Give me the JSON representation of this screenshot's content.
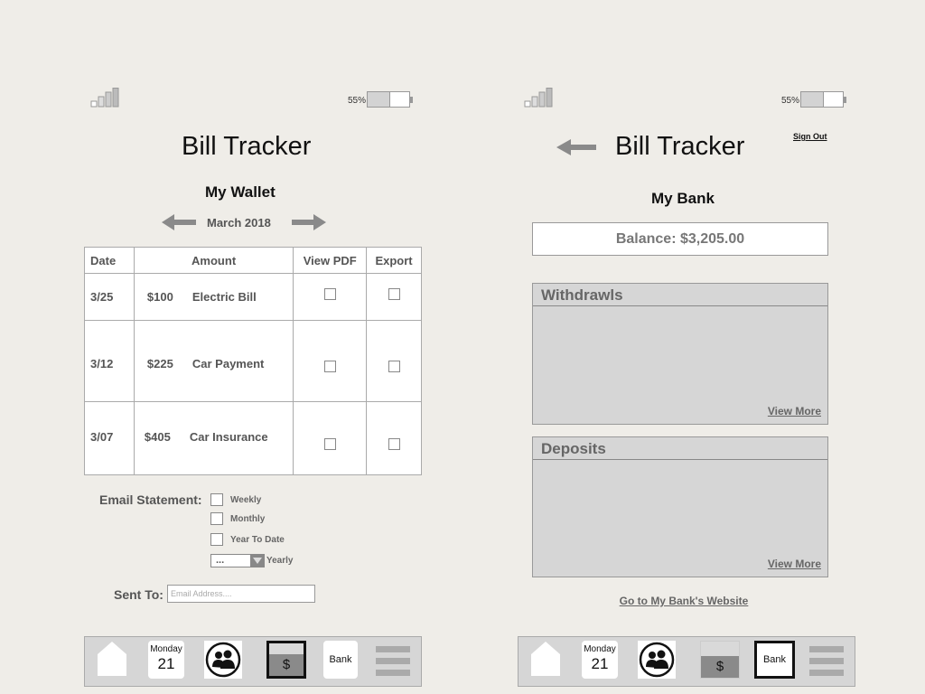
{
  "status": {
    "battery_label": "55%",
    "battery_level_percent": 55
  },
  "left": {
    "title": "Bill Tracker",
    "section": "My Wallet",
    "month": "March 2018",
    "table": {
      "headers": [
        "Date",
        "Amount",
        "View PDF",
        "Export"
      ],
      "rows": [
        {
          "date": "3/25",
          "amount": "$100",
          "description": "Electric Bill",
          "view_pdf": false,
          "export": false
        },
        {
          "date": "3/12",
          "amount": "$225",
          "description": "Car Payment",
          "view_pdf": false,
          "export": false
        },
        {
          "date": "3/07",
          "amount": "$405",
          "description": "Car Insurance",
          "view_pdf": false,
          "export": false
        }
      ]
    },
    "email_statement": {
      "label": "Email Statement:",
      "options": [
        "Weekly",
        "Monthly",
        "Year To Date"
      ],
      "select_value": "...",
      "select_label": "Yearly"
    },
    "sent_to": {
      "label": "Sent To:",
      "placeholder": "Email Address...."
    }
  },
  "right": {
    "title": "Bill Tracker",
    "sign_out": "Sign Out",
    "section": "My Bank",
    "balance": "Balance: $3,205.00",
    "withdrawals": {
      "title": "Withdrawls",
      "more": "View More"
    },
    "deposits": {
      "title": "Deposits",
      "more": "View More"
    },
    "bank_link": "Go to My Bank's Website"
  },
  "nav": {
    "day": "Monday",
    "date": "21",
    "wallet_symbol": "$",
    "bank_label": "Bank",
    "icons": [
      "home-icon",
      "calendar-icon",
      "contacts-icon",
      "wallet-icon",
      "bank-icon",
      "menu-icon"
    ]
  },
  "colors": {
    "background": "#efede8",
    "panel": "#d6d6d6",
    "active_border": "#111111"
  }
}
